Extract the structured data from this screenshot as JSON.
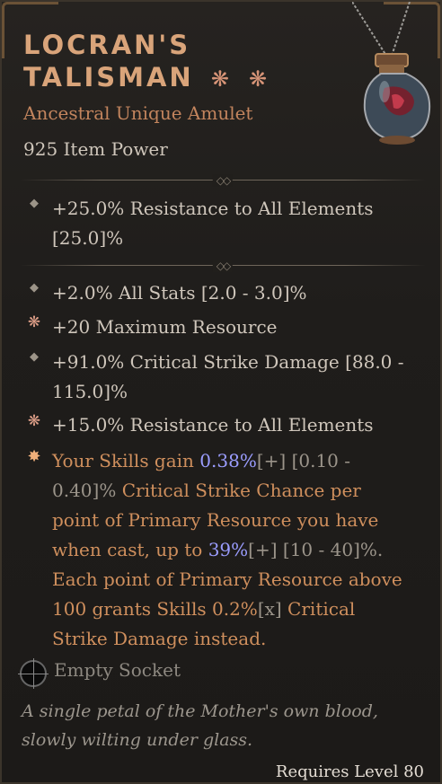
{
  "item": {
    "name_line1": "LOCRAN'S",
    "name_line2": "TALISMAN",
    "type": "Ancestral Unique Amulet",
    "item_power": "925 Item Power"
  },
  "implicit": {
    "line1": "+25.0% Resistance to All Elements",
    "line2": "[25.0]%"
  },
  "affixes": [
    {
      "text": "+2.0% All Stats [2.0 - 3.0]%"
    },
    {
      "text": "+20 Maximum Resource"
    },
    {
      "line1": "+91.0% Critical Strike Damage [88.0 -",
      "line2": "115.0]%"
    },
    {
      "text": "+15.0% Resistance to All Elements"
    }
  ],
  "unique_power": {
    "l1_a": "Your Skills gain ",
    "l1_val": "0.38%",
    "l1_plus": "[+]",
    "l1_range": " [0.10 -",
    "l2_range": "0.40]%",
    "l2_text": " Critical Strike Chance per",
    "l3": "point of Primary Resource you have",
    "l4_a": "when cast, up to ",
    "l4_val": "39%",
    "l4_plus": "[+]",
    "l4_range": " [10 - 40]%.",
    "l5": "Each point of Primary Resource above",
    "l6_a": "100 grants Skills ",
    "l6_val": "0.2%",
    "l6_x": "[x]",
    "l6_b": " Critical",
    "l7": "Strike Damage instead."
  },
  "socket": {
    "label": "Empty Socket"
  },
  "flavor": {
    "line1": "A single petal of the Mother's own blood,",
    "line2": "slowly wilting under glass."
  },
  "requirement": "Requires Level 80",
  "icons": {
    "greater_affix": "flower-icon",
    "normal_affix": "diamond-bullet-icon",
    "unique_power": "star-burst-icon",
    "socket": "socket-icon",
    "amulet": "potion-amulet-icon"
  },
  "colors": {
    "title": "#d9a47a",
    "unique_text": "#cf8f5d",
    "value_highlight": "#9b9dff",
    "body_text": "#cfc6bb"
  }
}
